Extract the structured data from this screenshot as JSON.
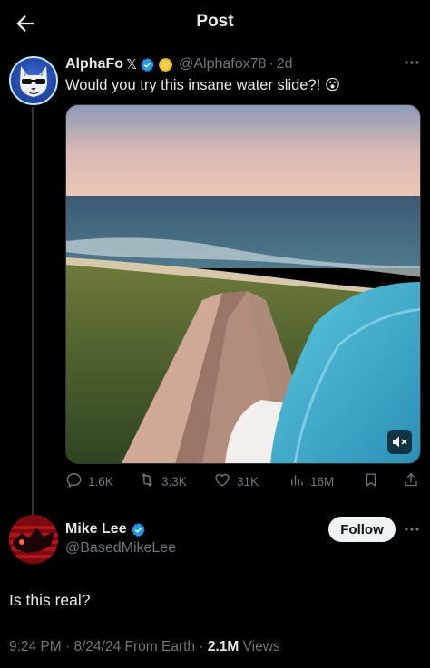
{
  "header": {
    "title": "Post"
  },
  "original_post": {
    "display_name": "AlphaFo",
    "x_glyph": "𝕏",
    "handle": "@Alphafox78",
    "separator": "·",
    "age": "2d",
    "text": "Would you try this insane water slide?! 😮",
    "stats": {
      "replies": "1.6K",
      "reposts": "3.3K",
      "likes": "31K",
      "views": "16M"
    }
  },
  "reply": {
    "display_name": "Mike Lee",
    "handle": "@BasedMikeLee",
    "follow_label": "Follow",
    "text": "Is this real?",
    "timestamp": "9:24 PM · 8/24/24 From Earth · ",
    "view_count": "2.1M",
    "views_label": " Views"
  },
  "colors": {
    "background": "#000000",
    "text_primary": "#e7e9ea",
    "text_secondary": "#71767b",
    "verified_blue": "#1d9bf0",
    "gold_badge": "#e8b923",
    "divider": "#333639"
  },
  "icons": [
    "back-arrow-icon",
    "verified-icon",
    "gold-badge-icon",
    "more-icon",
    "reply-icon",
    "repost-icon",
    "like-icon",
    "views-icon",
    "bookmark-icon",
    "share-icon",
    "mute-icon"
  ]
}
